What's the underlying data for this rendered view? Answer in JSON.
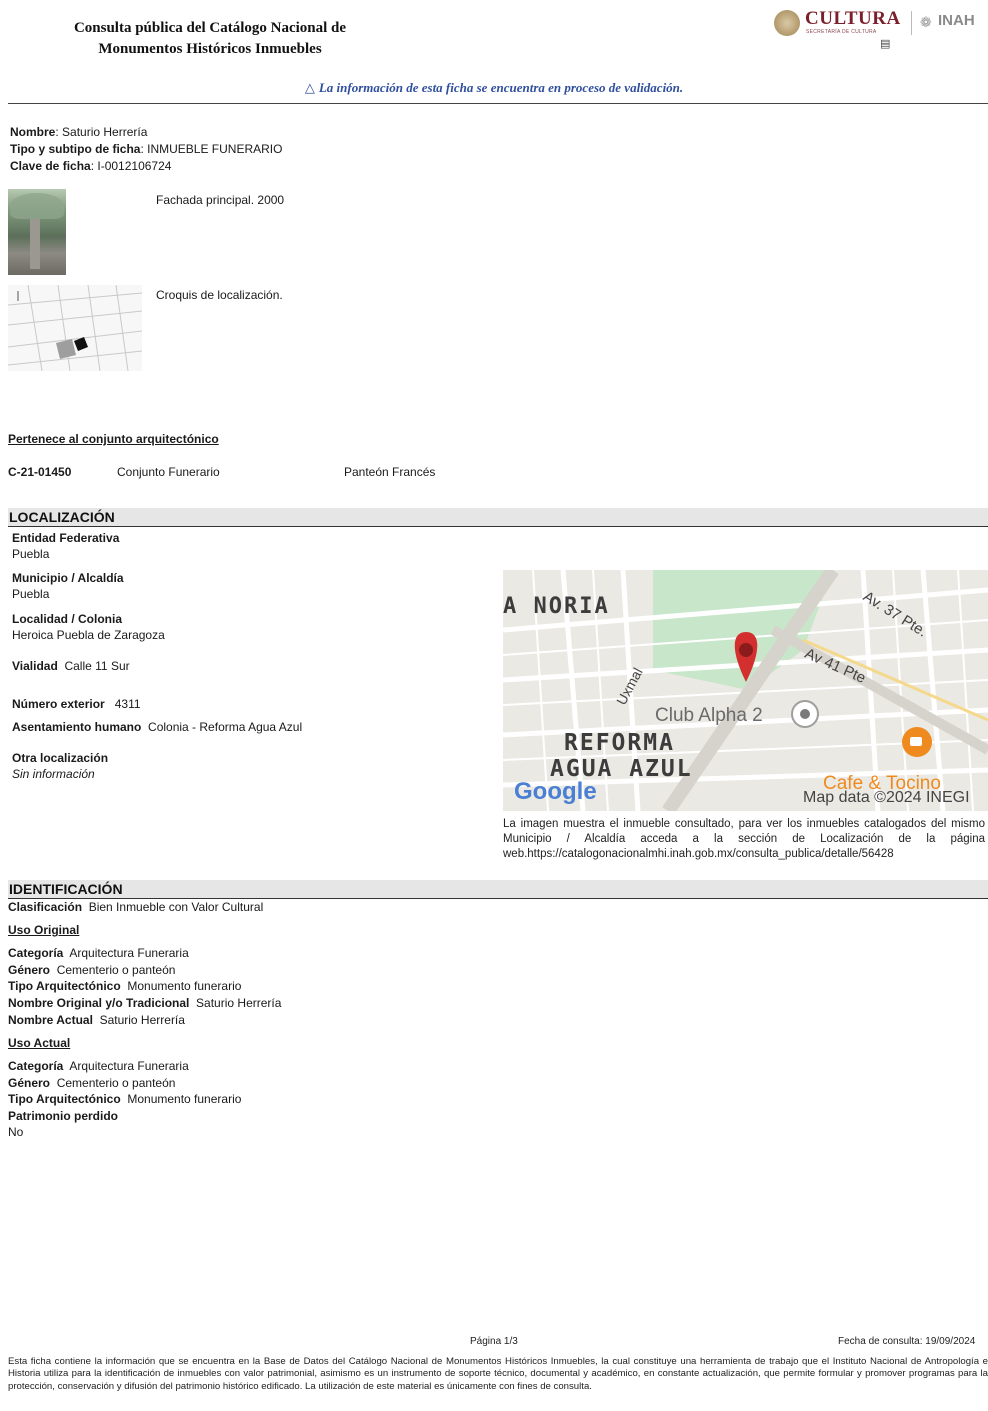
{
  "header": {
    "title_line1": "Consulta pública del Catálogo Nacional de",
    "title_line2": "Monumentos Históricos Inmuebles",
    "logo_cultura": "CULTURA",
    "logo_cultura_sub": "SECRETARÍA DE CULTURA",
    "logo_inah": "INAH",
    "notice": "La información de esta ficha se encuentra en proceso de validación."
  },
  "summary": {
    "nombre_label": "Nombre",
    "nombre_value": "Saturio Herrería",
    "tipo_label": "Tipo y subtipo de ficha",
    "tipo_value": "INMUEBLE FUNERARIO",
    "clave_label": "Clave de ficha",
    "clave_value": "I-0012106724"
  },
  "images": [
    {
      "caption": "Fachada principal. 2000"
    },
    {
      "caption": "Croquis de localización."
    }
  ],
  "conjunto": {
    "heading": "Pertenece al conjunto arquitectónico",
    "code": "C-21-01450",
    "type": "Conjunto Funerario",
    "name": "Panteón Francés"
  },
  "localizacion": {
    "heading": "LOCALIZACIÓN",
    "entidad_label": "Entidad Federativa",
    "entidad_value": "Puebla",
    "municipio_label": "Municipio / Alcaldía",
    "municipio_value": "Puebla",
    "localidad_label": "Localidad / Colonia",
    "localidad_value": "Heroica Puebla de Zaragoza",
    "vialidad_label": "Vialidad",
    "vialidad_value": "Calle 11 Sur",
    "numero_label": "Número exterior",
    "numero_value": "4311",
    "asentamiento_label": "Asentamiento humano",
    "asentamiento_value": "Colonia - Reforma Agua Azul",
    "otra_label": "Otra localización",
    "otra_value": "Sin información"
  },
  "map": {
    "label_noria": "A NORIA",
    "label_37": "Av. 37 Pte.",
    "label_41": "Av 41 Pte",
    "label_uxmal": "Uxmal",
    "label_club": "Club Alpha 2",
    "label_reforma1": "REFORMA",
    "label_reforma2": "AGUA AZUL",
    "label_cafe": "Cafe & Tocino",
    "google": "Google",
    "map_data": "Map data ©2024 INEGI",
    "caption": "La imagen muestra el inmueble consultado, para ver los inmuebles catalogados del mismo Municipio / Alcaldía acceda a la sección de Localización de la página web.https://catalogonacionalmhi.inah.gob.mx/consulta_publica/detalle/56428",
    "colors": {
      "pin": "#d32f2f",
      "park": "#c8e6c9",
      "road": "#ffffff",
      "cafe": "#ef8a1e"
    }
  },
  "identificacion": {
    "heading": "IDENTIFICACIÓN",
    "clasificacion_label": "Clasificación",
    "clasificacion_value": "Bien Inmueble con Valor Cultural",
    "uso_original_heading": "Uso Original",
    "uso_original": {
      "categoria_label": "Categoría",
      "categoria_value": "Arquitectura Funeraria",
      "genero_label": "Género",
      "genero_value": "Cementerio o panteón",
      "tipo_label": "Tipo Arquitectónico",
      "tipo_value": "Monumento funerario",
      "nombre_orig_label": "Nombre Original y/o Tradicional",
      "nombre_orig_value": "Saturio Herrería",
      "nombre_actual_label": "Nombre Actual",
      "nombre_actual_value": "Saturio Herrería"
    },
    "uso_actual_heading": "Uso Actual",
    "uso_actual": {
      "categoria_label": "Categoría",
      "categoria_value": "Arquitectura Funeraria",
      "genero_label": "Género",
      "genero_value": "Cementerio o panteón",
      "tipo_label": "Tipo Arquitectónico",
      "tipo_value": "Monumento funerario"
    },
    "patrimonio_label": "Patrimonio perdido",
    "patrimonio_value": "No"
  },
  "footer": {
    "page": "Página 1/3",
    "date": "Fecha de consulta: 19/09/2024",
    "text": "Esta ficha contiene la información que se encuentra en la Base de Datos del Catálogo Nacional de Monumentos Históricos Inmuebles, la cual constituye una herramienta de trabajo que el Instituto Nacional de Antropología e Historia utiliza para la identificación de inmuebles con valor patrimonial, asimismo es un instrumento de soporte técnico, documental y académico, en constante actualización, que permite formular y promover programas para la protección, conservación y difusión del patrimonio histórico edificado. La utilización de este material es únicamente con fines de consulta."
  }
}
